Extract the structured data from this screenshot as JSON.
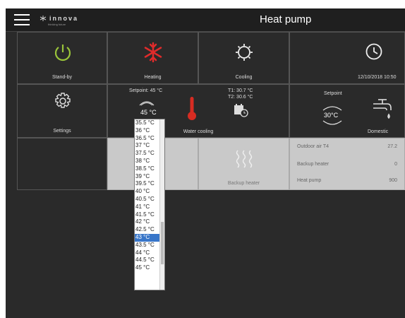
{
  "header": {
    "title": "Heat pump",
    "logo_name": "innova",
    "logo_tagline": "thinking future"
  },
  "tiles": {
    "standby": {
      "label": "Stand-by"
    },
    "heating": {
      "label": "Heating"
    },
    "cooling": {
      "label": "Cooling"
    },
    "clock": {
      "datetime": "12/10/2018 10:50"
    },
    "settings": {
      "label": "Settings"
    },
    "water_cooling": {
      "label": "Water cooling",
      "setpoint_label": "Setpoint: 45 °C",
      "setpoint_value": "45 °C",
      "t1": "T1: 30.7 °C",
      "t2": "T2: 30.6 °C"
    },
    "domestic": {
      "label": "Domestic",
      "setpoint_label": "Setpoint",
      "setpoint_value": "30°C"
    },
    "backup_heater": {
      "label": "Backup heater"
    },
    "info": {
      "rows": [
        {
          "label": "Outdoor air T4",
          "value": "27.2"
        },
        {
          "label": "Backup heater",
          "value": "0"
        },
        {
          "label": "Heat pump",
          "value": "900"
        }
      ]
    }
  },
  "setpoint_dropdown": {
    "options": [
      "35.5 °C",
      "36 °C",
      "36.5 °C",
      "37 °C",
      "37.5 °C",
      "38 °C",
      "38.5 °C",
      "39 °C",
      "39.5 °C",
      "40 °C",
      "40.5 °C",
      "41 °C",
      "41.5 °C",
      "42 °C",
      "42.5 °C",
      "43 °C",
      "43.5 °C",
      "44 °C",
      "44.5 °C",
      "45 °C"
    ],
    "selected": "43 °C"
  },
  "colors": {
    "standby_icon": "#9ac43a",
    "heating_icon": "#e02b2b",
    "thermo_icon": "#d72c22",
    "selected_option": "#3876c9"
  }
}
